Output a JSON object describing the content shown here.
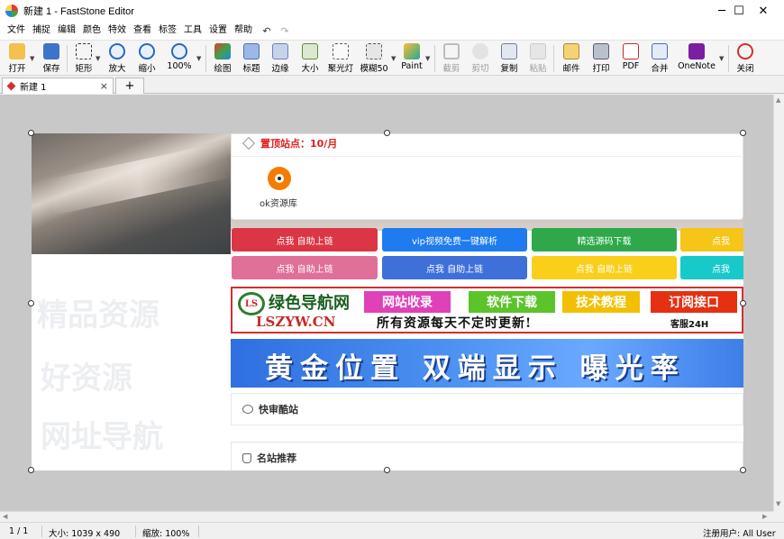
{
  "window": {
    "title": "新建 1 - FastStone Editor",
    "minimize_glyph": "─",
    "maximize_glyph": "☐",
    "close_glyph": "✕"
  },
  "menu": [
    "文件",
    "捕捉",
    "编辑",
    "颜色",
    "特效",
    "查看",
    "标签",
    "工具",
    "设置",
    "帮助"
  ],
  "quick_actions": {
    "undo_glyph": "↶",
    "redo_glyph": "↷"
  },
  "toolbar": {
    "open": "打开",
    "save": "保存",
    "rect": "矩形",
    "zoom_in": "放大",
    "zoom_out": "缩小",
    "zoom_100": "100%",
    "draw": "绘图",
    "caption": "标题",
    "edge": "边缘",
    "resize": "大小",
    "spotlight": "聚光灯",
    "blur": "模糊50",
    "paint": "Paint",
    "crop": "截剪",
    "cut": "剪切",
    "copy": "复制",
    "paste": "粘贴",
    "email": "邮件",
    "print": "打印",
    "pdf": "PDF",
    "merge": "合并",
    "onenote": "OneNote",
    "close": "关闭"
  },
  "tabs": {
    "doc_tab_label": "新建 1",
    "doc_tab_close": "×",
    "new_tab": "+"
  },
  "image": {
    "pinned_title": "置顶站点：10/月",
    "site_name": "ok资源库",
    "links_row1": [
      "点我 自助上链",
      "vip视频免费一键解析",
      "精选源码下载",
      "点我"
    ],
    "links_row2": [
      "点我 自助上链",
      "点我 自助上链",
      "点我 自助上链",
      "点我"
    ],
    "banner1": {
      "logo_letters": "LS",
      "logo_name": "绿色导航网",
      "logo_url": "LSZYW.CN",
      "pills": [
        "网站收录",
        "软件下载",
        "技术教程",
        "订阅接口"
      ],
      "slogan": "所有资源每天不定时更新!",
      "service": "客服24H"
    },
    "banner2_text": "黄金位置 双端显示 曝光率",
    "section1": "快审酷站",
    "section2": "名站推荐",
    "ghost_text": [
      "精品资源",
      "好资源",
      "网址导航"
    ]
  },
  "colors": {
    "red": "#dc3545",
    "blue": "#1e7bf0",
    "green": "#2ea84a",
    "yellow": "#f5c518",
    "pink": "#e07098",
    "indigo": "#3f6fd8",
    "gold": "#f9cf1a",
    "cyan": "#18c9c9"
  },
  "status": {
    "page": "1 / 1",
    "size": "大小:  1039 x 490",
    "zoom": "缩放:  100%",
    "user": "注册用户:  All User"
  }
}
